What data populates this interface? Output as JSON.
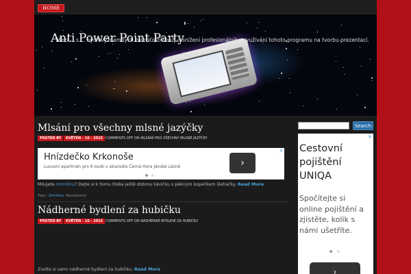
{
  "nav": {
    "home_label": "HOME"
  },
  "header": {
    "title": "Anti Power Point Party",
    "description": "Mezi ... s ... ných významných záležitostí snaží o snížení profesionálního využívání tohoto programu na tvorbu prezentací."
  },
  "posts": [
    {
      "title": "Mlsání pro všechny mlsné jazýčky",
      "posted_by": "POSTED BY",
      "date": "KVĚTEN - 10 - 2015",
      "comments": "COMMENTS OFF ON MLSÁNÍ PRO VŠECHNY MLSNÉ JAZÝČKY",
      "ad": {
        "title": "Hnízdečko Krkonoše",
        "subtitle": "Luxusní apartmán pro 6 osob u skiareálu Černá Hora Jánské Lázně",
        "arrow": "›",
        "close": "✕"
      },
      "excerpt_before": "Milujete ",
      "excerpt_link": "zmrzlinu",
      "excerpt_after": "? Dejte si k tomu třeba ještě dobrou kávičku s pěkným kopečkem šlehačky. ",
      "read_more": "Read More",
      "tags_label": "Tags : ",
      "tag": "Zmrzlina",
      "category": "Nezařazené"
    },
    {
      "title": "Nádherné bydlení za hubičku",
      "posted_by": "POSTED BY",
      "date": "KVĚTEN - 10 - 2015",
      "comments": "COMMENTS OFF ON NÁDHERNÉ BYDLENÍ ZA HUBIČKU",
      "excerpt": "Zvolte si sami nádherné bydlení za hubičku. ",
      "read_more": "Read More"
    }
  ],
  "sidebar": {
    "search_placeholder": "",
    "search_button": "Search",
    "ad": {
      "title": "Cestovní pojištění UNIQA",
      "text": "Spočítejte si online pojištění a zjistěte, kolik s námi ušetříte.",
      "arrow": "›",
      "close": "✕"
    }
  },
  "colors": {
    "page_background": "#b01217",
    "accent_red": "#c4161c",
    "link_blue": "#4aa3df",
    "content_background": "#1b1b1b"
  }
}
